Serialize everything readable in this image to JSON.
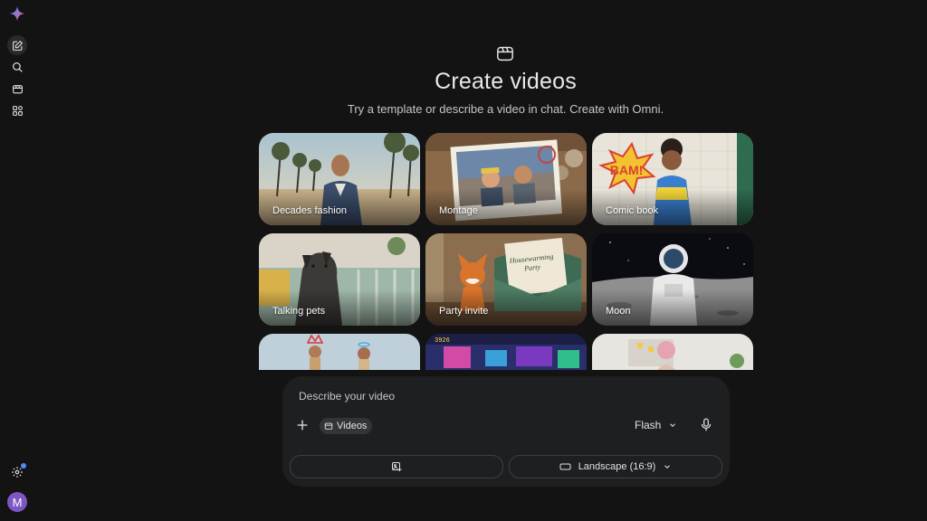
{
  "header": {
    "title": "Create videos",
    "subtitle": "Try a template or describe a video in chat. Create with Omni."
  },
  "templates": [
    {
      "label": "Decades fashion"
    },
    {
      "label": "Montage"
    },
    {
      "label": "Comic book"
    },
    {
      "label": "Talking pets"
    },
    {
      "label": "Party invite"
    },
    {
      "label": "Moon"
    }
  ],
  "scene_text": {
    "comic_bam": "BAM!",
    "invite_line1": "Housewarming",
    "invite_line2": "Party",
    "game_score": "3926"
  },
  "prompt": {
    "placeholder": "Describe your video",
    "chip_label": "Videos",
    "model_label": "Flash",
    "aspect_label": "Landscape (16:9)"
  },
  "user": {
    "avatar_initial": "M"
  },
  "colors": {
    "background": "#131314",
    "panel": "#1e1f20",
    "notification": "#4c8df6",
    "avatar": "#7e57c2"
  },
  "icons": {
    "logo": "gemini-sparkle-icon",
    "new_chat": "edit-icon",
    "search": "search-icon",
    "videos": "video-icon",
    "apps": "apps-icon",
    "settings": "gear-icon",
    "add": "plus-icon",
    "model_dropdown": "chevron-down-icon",
    "mic": "mic-icon",
    "image": "add-image-icon",
    "aspect": "aspect-ratio-icon"
  }
}
